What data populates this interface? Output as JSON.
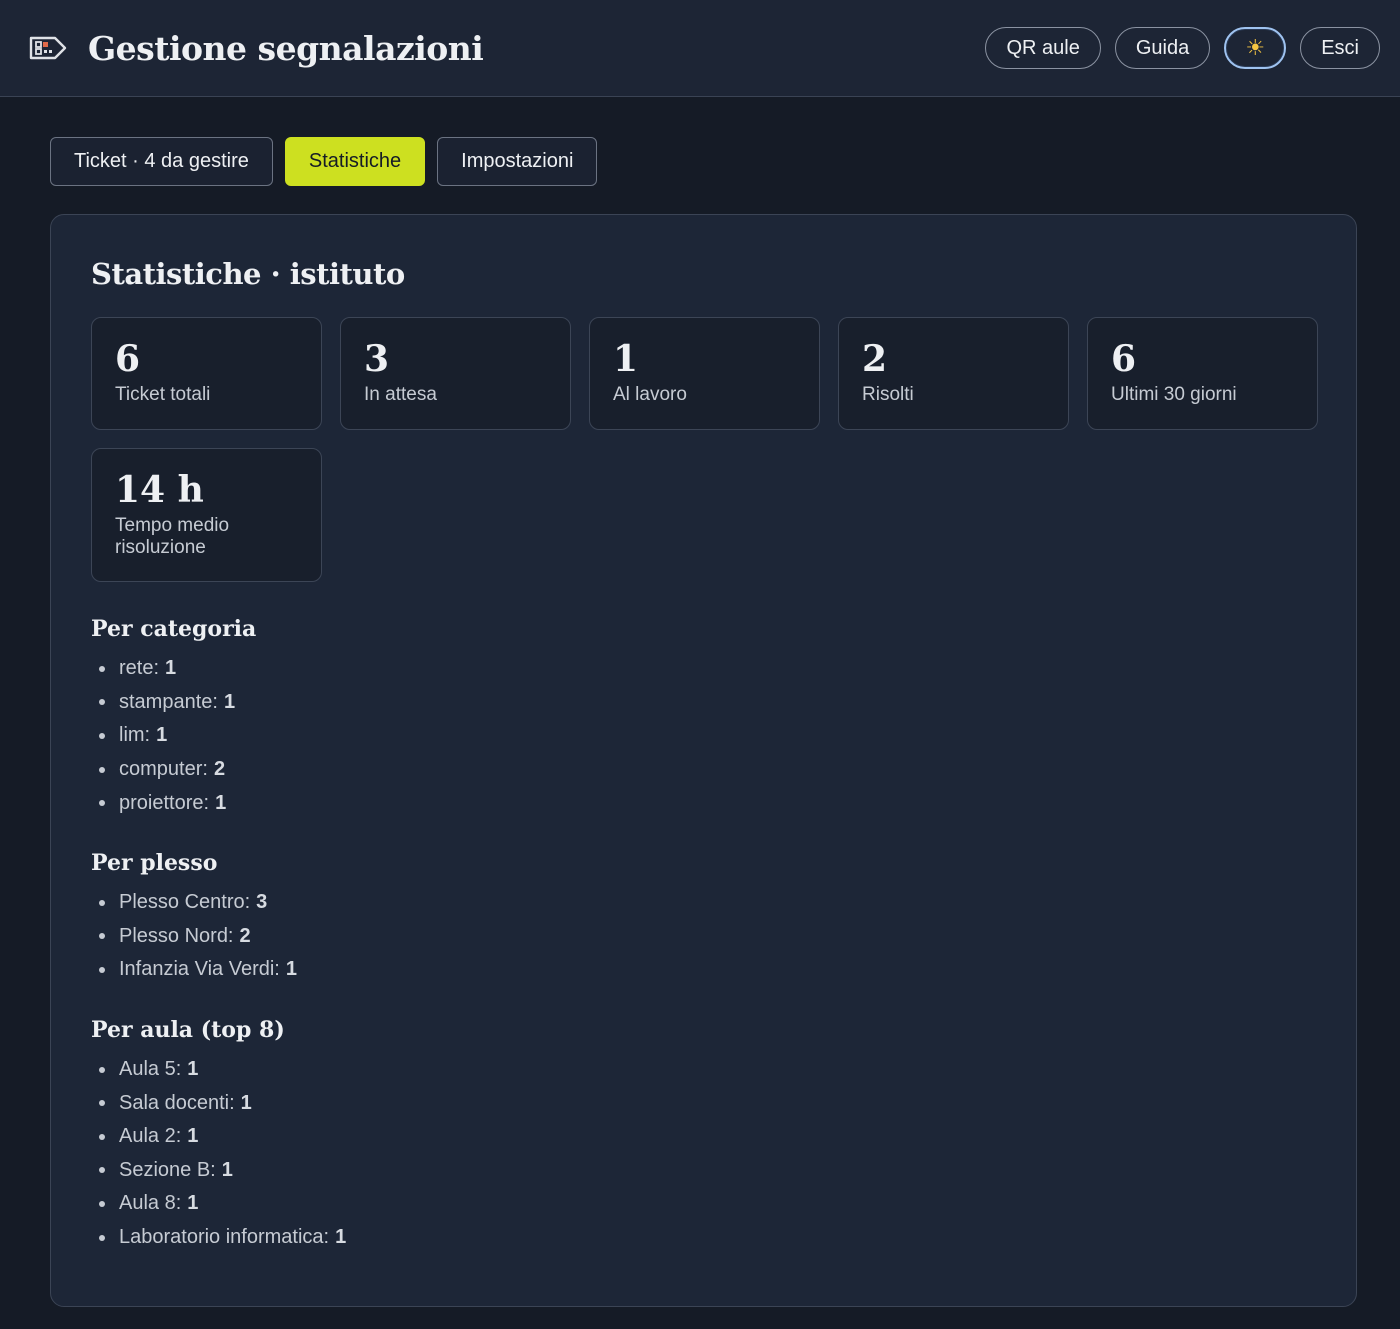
{
  "header": {
    "title": "Gestione segnalazioni",
    "logo_icon": "ticket-tag-icon",
    "actions": {
      "qr_label": "QR aule",
      "guide_label": "Guida",
      "theme_icon": "sun-icon",
      "theme_glyph": "☀",
      "logout_label": "Esci"
    }
  },
  "tabs": {
    "ticket_label": "Ticket · 4 da gestire",
    "stats_label": "Statistiche",
    "settings_label": "Impostazioni",
    "active": "Statistiche",
    "active_color": "#cde020"
  },
  "stats": {
    "title": "Statistiche · istituto",
    "cards": [
      {
        "value": "6",
        "label": "Ticket totali"
      },
      {
        "value": "3",
        "label": "In attesa"
      },
      {
        "value": "1",
        "label": "Al lavoro"
      },
      {
        "value": "2",
        "label": "Risolti"
      },
      {
        "value": "6",
        "label": "Ultimi 30 giorni"
      },
      {
        "value": "14 h",
        "label": "Tempo medio risoluzione"
      }
    ],
    "by_category": {
      "title": "Per categoria",
      "items": [
        {
          "name": "rete:",
          "count": "1"
        },
        {
          "name": "stampante:",
          "count": "1"
        },
        {
          "name": "lim:",
          "count": "1"
        },
        {
          "name": "computer:",
          "count": "2"
        },
        {
          "name": "proiettore:",
          "count": "1"
        }
      ]
    },
    "by_site": {
      "title": "Per plesso",
      "items": [
        {
          "name": "Plesso Centro:",
          "count": "3"
        },
        {
          "name": "Plesso Nord:",
          "count": "2"
        },
        {
          "name": "Infanzia Via Verdi:",
          "count": "1"
        }
      ]
    },
    "by_room": {
      "title": "Per aula (top 8)",
      "items": [
        {
          "name": "Aula 5:",
          "count": "1"
        },
        {
          "name": "Sala docenti:",
          "count": "1"
        },
        {
          "name": "Aula 2:",
          "count": "1"
        },
        {
          "name": "Sezione B:",
          "count": "1"
        },
        {
          "name": "Aula 8:",
          "count": "1"
        },
        {
          "name": "Laboratorio informatica:",
          "count": "1"
        }
      ]
    }
  }
}
